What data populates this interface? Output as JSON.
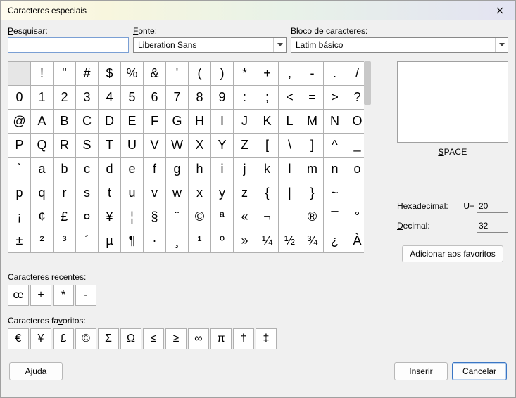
{
  "window": {
    "title": "Caracteres especiais"
  },
  "labels": {
    "search": "Pesquisar:",
    "font": "Fonte:",
    "block": "Bloco de caracteres:",
    "recent": "Caracteres recentes:",
    "favorites": "Caracteres favoritos:",
    "hex": "Hexadecimal:",
    "hex_prefix": "U+",
    "dec": "Decimal:",
    "add_fav": "Adicionar aos favoritos"
  },
  "inputs": {
    "search_value": "",
    "font_selected": "Liberation Sans",
    "block_selected": "Latim básico",
    "hex_value": "20",
    "dec_value": "32"
  },
  "preview": {
    "name": "SPACE"
  },
  "buttons": {
    "help": "Ajuda",
    "insert": "Inserir",
    "cancel": "Cancelar"
  },
  "grid_chars": [
    " ",
    "!",
    "\"",
    "#",
    "$",
    "%",
    "&",
    "'",
    "(",
    ")",
    "*",
    "+",
    ",",
    "-",
    ".",
    "/",
    "0",
    "1",
    "2",
    "3",
    "4",
    "5",
    "6",
    "7",
    "8",
    "9",
    ":",
    ";",
    "<",
    "=",
    ">",
    "?",
    "@",
    "A",
    "B",
    "C",
    "D",
    "E",
    "F",
    "G",
    "H",
    "I",
    "J",
    "K",
    "L",
    "M",
    "N",
    "O",
    "P",
    "Q",
    "R",
    "S",
    "T",
    "U",
    "V",
    "W",
    "X",
    "Y",
    "Z",
    "[",
    "\\",
    "]",
    "^",
    "_",
    "`",
    "a",
    "b",
    "c",
    "d",
    "e",
    "f",
    "g",
    "h",
    "i",
    "j",
    "k",
    "l",
    "m",
    "n",
    "o",
    "p",
    "q",
    "r",
    "s",
    "t",
    "u",
    "v",
    "w",
    "x",
    "y",
    "z",
    "{",
    "|",
    "}",
    "~",
    " ",
    "¡",
    "¢",
    "£",
    "¤",
    "¥",
    "¦",
    "§",
    "¨",
    "©",
    "ª",
    "«",
    "¬",
    " ",
    "®",
    "¯",
    "°",
    "±",
    "²",
    "³",
    "´",
    "µ",
    "¶",
    "·",
    "¸",
    "¹",
    "º",
    "»",
    "¼",
    "½",
    "¾",
    "¿",
    "À"
  ],
  "selected_index": 0,
  "recent_chars": [
    "œ",
    "+",
    "*",
    "-"
  ],
  "favorite_chars": [
    "€",
    "¥",
    "£",
    "©",
    "Σ",
    "Ω",
    "≤",
    "≥",
    "∞",
    "π",
    "†",
    "‡"
  ]
}
